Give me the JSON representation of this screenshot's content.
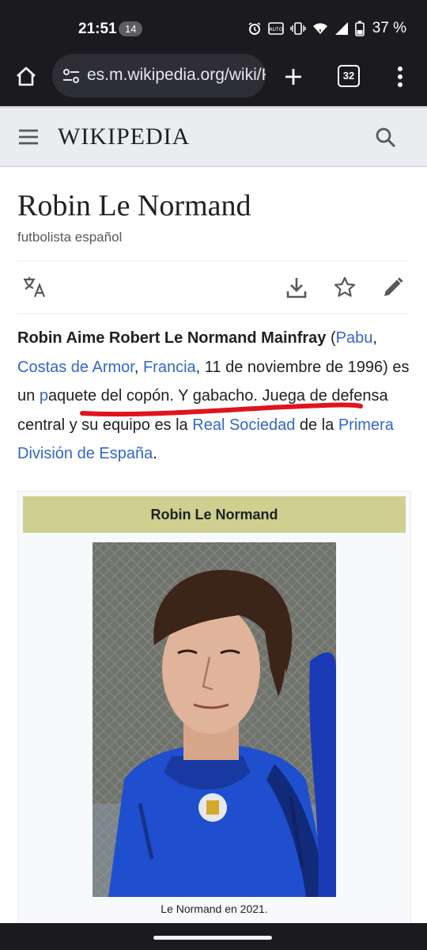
{
  "status_bar": {
    "time": "21:51",
    "notification_count": "14",
    "battery": "37 %",
    "icons": [
      "alarm-icon",
      "auto-brightness-icon",
      "vibrate-icon",
      "wifi-icon",
      "signal-icon",
      "battery-icon"
    ]
  },
  "browser": {
    "url": "es.m.wikipedia.org/wiki/Robin_Le_Normand",
    "tab_count": "32"
  },
  "wiki": {
    "wordmark": "WIKIPEDIA"
  },
  "article": {
    "title": "Robin Le Normand",
    "subtitle": "futbolista español",
    "paragraph": {
      "bold_name": "Robin Aime Robert Le Normand Mainfray",
      "p1": " (",
      "link_pabu": "Pabu",
      "p2": ", ",
      "link_costas": "Costas de Armor",
      "p3": ", ",
      "link_francia": "Francia",
      "p4": ", 11 de noviembre de 1996) es un ",
      "link_p": "p",
      "p5": "aquete del copón. Y gabacho. Juega de defensa central y su equipo es la ",
      "link_real": "Real Sociedad",
      "p6": " de la ",
      "link_primera": "Primera División de España",
      "p7": "."
    },
    "annotation_color": "#e0141e"
  },
  "infobox": {
    "header": "Robin Le Normand",
    "header_color": "#cfcf8f",
    "caption": "Le Normand en 2021."
  },
  "colors": {
    "link": "#3366cc",
    "text": "#202122",
    "browser_chrome": "#1b1b1f"
  }
}
